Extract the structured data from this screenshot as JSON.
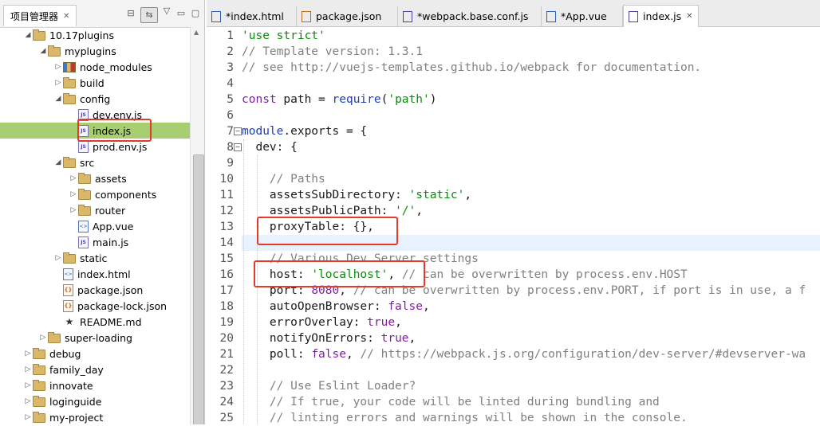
{
  "explorer": {
    "tab_label": "项目管理器",
    "close_glyph": "✕",
    "buttons": {
      "collapse": "⊟",
      "link": "⇆",
      "menu": "▽",
      "minimize": "▭",
      "maximize": "▢"
    },
    "items": [
      {
        "label": "10.17plugins",
        "icon": "folder-icon",
        "expanded": true
      },
      {
        "label": "myplugins",
        "icon": "folder-icon",
        "expanded": true
      },
      {
        "label": "node_modules",
        "icon": "library-folder-icon",
        "expanded": false
      },
      {
        "label": "build",
        "icon": "folder-icon",
        "expanded": false
      },
      {
        "label": "config",
        "icon": "folder-icon",
        "expanded": true
      },
      {
        "label": "dev.env.js",
        "icon": "js-file-icon"
      },
      {
        "label": "index.js",
        "icon": "js-file-icon",
        "selected": true
      },
      {
        "label": "prod.env.js",
        "icon": "js-file-icon"
      },
      {
        "label": "src",
        "icon": "folder-icon",
        "expanded": true
      },
      {
        "label": "assets",
        "icon": "folder-icon",
        "expanded": false
      },
      {
        "label": "components",
        "icon": "folder-icon",
        "expanded": false
      },
      {
        "label": "router",
        "icon": "folder-icon",
        "expanded": false
      },
      {
        "label": "App.vue",
        "icon": "vue-file-icon"
      },
      {
        "label": "main.js",
        "icon": "js-file-icon"
      },
      {
        "label": "static",
        "icon": "folder-icon",
        "expanded": false
      },
      {
        "label": "index.html",
        "icon": "html-file-icon"
      },
      {
        "label": "package.json",
        "icon": "json-file-icon"
      },
      {
        "label": "package-lock.json",
        "icon": "json-file-icon"
      },
      {
        "label": "README.md",
        "icon": "star-file-icon"
      },
      {
        "label": "super-loading",
        "icon": "folder-icon",
        "expanded": false
      },
      {
        "label": "debug",
        "icon": "folder-icon",
        "expanded": false
      },
      {
        "label": "family_day",
        "icon": "folder-icon",
        "expanded": false
      },
      {
        "label": "innovate",
        "icon": "folder-icon",
        "expanded": false
      },
      {
        "label": "loginguide",
        "icon": "folder-icon",
        "expanded": false
      },
      {
        "label": "my-project",
        "icon": "folder-icon",
        "expanded": false
      }
    ]
  },
  "editor": {
    "tabs": [
      {
        "label": "*index.html",
        "icon": "html-file-icon"
      },
      {
        "label": "package.json",
        "icon": "json-file-icon"
      },
      {
        "label": "*webpack.base.conf.js",
        "icon": "js-file-icon"
      },
      {
        "label": "*App.vue",
        "icon": "vue-file-icon"
      },
      {
        "label": "index.js",
        "icon": "js-file-icon",
        "active": true
      }
    ],
    "tab_close_glyph": "✕",
    "fold_glyph": "−",
    "current_line": 14,
    "lines": [
      {
        "n": "1",
        "text": "'use strict'"
      },
      {
        "n": "2",
        "text": "// Template version: 1.3.1"
      },
      {
        "n": "3",
        "text": "// see http://vuejs-templates.github.io/webpack for documentation."
      },
      {
        "n": "4",
        "text": ""
      },
      {
        "n": "5",
        "text": "const path = require('path')"
      },
      {
        "n": "6",
        "text": ""
      },
      {
        "n": "7",
        "text": "module.exports = {"
      },
      {
        "n": "8",
        "text": "  dev: {"
      },
      {
        "n": "9",
        "text": ""
      },
      {
        "n": "10",
        "text": "    // Paths"
      },
      {
        "n": "11",
        "text": "    assetsSubDirectory: 'static',"
      },
      {
        "n": "12",
        "text": "    assetsPublicPath: '/',"
      },
      {
        "n": "13",
        "text": "    proxyTable: {},"
      },
      {
        "n": "14",
        "text": ""
      },
      {
        "n": "15",
        "text": "    // Various Dev Server settings"
      },
      {
        "n": "16",
        "text": "    host: 'localhost', // can be overwritten by process.env.HOST"
      },
      {
        "n": "17",
        "text": "    port: 8080, // can be overwritten by process.env.PORT, if port is in use, a f"
      },
      {
        "n": "18",
        "text": "    autoOpenBrowser: false,"
      },
      {
        "n": "19",
        "text": "    errorOverlay: true,"
      },
      {
        "n": "20",
        "text": "    notifyOnErrors: true,"
      },
      {
        "n": "21",
        "text": "    poll: false, // https://webpack.js.org/configuration/dev-server/#devserver-wa"
      },
      {
        "n": "22",
        "text": ""
      },
      {
        "n": "23",
        "text": "    // Use Eslint Loader?"
      },
      {
        "n": "24",
        "text": "    // If true, your code will be linted during bundling and"
      },
      {
        "n": "25",
        "text": "    // linting errors and warnings will be shown in the console."
      }
    ]
  },
  "colors": {
    "selection": "#a7cf71",
    "annotation_box": "#e23b2e",
    "string": "#0a8a0a",
    "comment": "#808080",
    "keyword": "#1f3fb3"
  }
}
